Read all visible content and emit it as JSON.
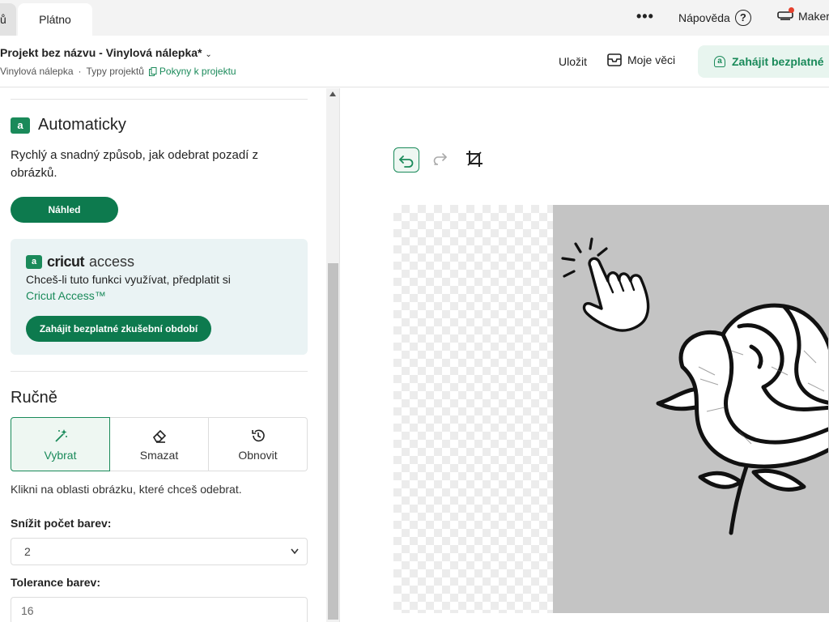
{
  "tabs": {
    "previous_label": "ů",
    "active_label": "Plátno"
  },
  "topbar": {
    "more_label": "•••",
    "help_label": "Nápověda",
    "help_icon_glyph": "?",
    "maker_label": "Maker"
  },
  "project": {
    "title": "Projekt bez názvu - Vinylová nálepka*",
    "type": "Vinylová nálepka",
    "separator": "·",
    "types_link": "Typy projektů",
    "instructions_link": "Pokyny k projektu"
  },
  "header_actions": {
    "save_label": "Uložit",
    "my_stuff_label": "Moje věci",
    "trial_label": "Zahájit bezplatné"
  },
  "auto_section": {
    "badge_glyph": "a",
    "heading": "Automaticky",
    "description": "Rychlý a snadný způsob, jak odebrat pozadí z obrázků.",
    "preview_button": "Náhled"
  },
  "access_card": {
    "badge_glyph": "a",
    "brand": "cricut",
    "brand_word": "access",
    "text": "Chceš-li tuto funkci využívat, předplatit si",
    "link": "Cricut Access™",
    "trial_button": "Zahájit bezplatné zkušební období"
  },
  "manual_section": {
    "heading": "Ručně",
    "tools": [
      {
        "label": "Vybrat",
        "icon": "magic-wand-icon",
        "active": true
      },
      {
        "label": "Smazat",
        "icon": "eraser-icon",
        "active": false
      },
      {
        "label": "Obnovit",
        "icon": "restore-icon",
        "active": false
      }
    ],
    "hint": "Klikni na oblasti obrázku, které chceš odebrat.",
    "reduce_colors_label": "Snížit počet barev:",
    "reduce_colors_value": "2",
    "tolerance_label": "Tolerance barev:",
    "tolerance_value": "16"
  },
  "colors": {
    "accent": "#1a8a5a",
    "accent_dark": "#0d7a4e",
    "accent_light": "#eef7f2",
    "card_bg": "#eaf3f4",
    "image_bg": "#c4c4c4"
  }
}
